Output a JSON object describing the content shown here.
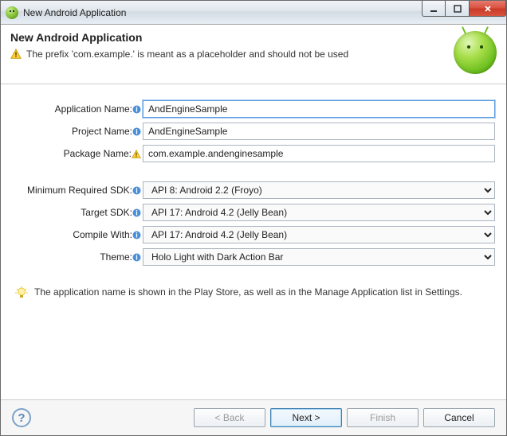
{
  "window": {
    "title": "New Android Application"
  },
  "header": {
    "heading": "New Android Application",
    "warning": "The prefix 'com.example.' is meant as a placeholder and should not be used"
  },
  "form": {
    "app_name_label": "Application Name:",
    "app_name_value": "AndEngineSample",
    "project_name_label": "Project Name:",
    "project_name_value": "AndEngineSample",
    "package_name_label": "Package Name:",
    "package_name_value": "com.example.andenginesample",
    "min_sdk_label": "Minimum Required SDK:",
    "min_sdk_value": "API 8: Android 2.2 (Froyo)",
    "target_sdk_label": "Target SDK:",
    "target_sdk_value": "API 17: Android 4.2 (Jelly Bean)",
    "compile_with_label": "Compile With:",
    "compile_with_value": "API 17: Android 4.2 (Jelly Bean)",
    "theme_label": "Theme:",
    "theme_value": "Holo Light with Dark Action Bar"
  },
  "hint": "The application name is shown in the Play Store, as well as in the Manage Application list in Settings.",
  "footer": {
    "back": "< Back",
    "next": "Next >",
    "finish": "Finish",
    "cancel": "Cancel"
  }
}
